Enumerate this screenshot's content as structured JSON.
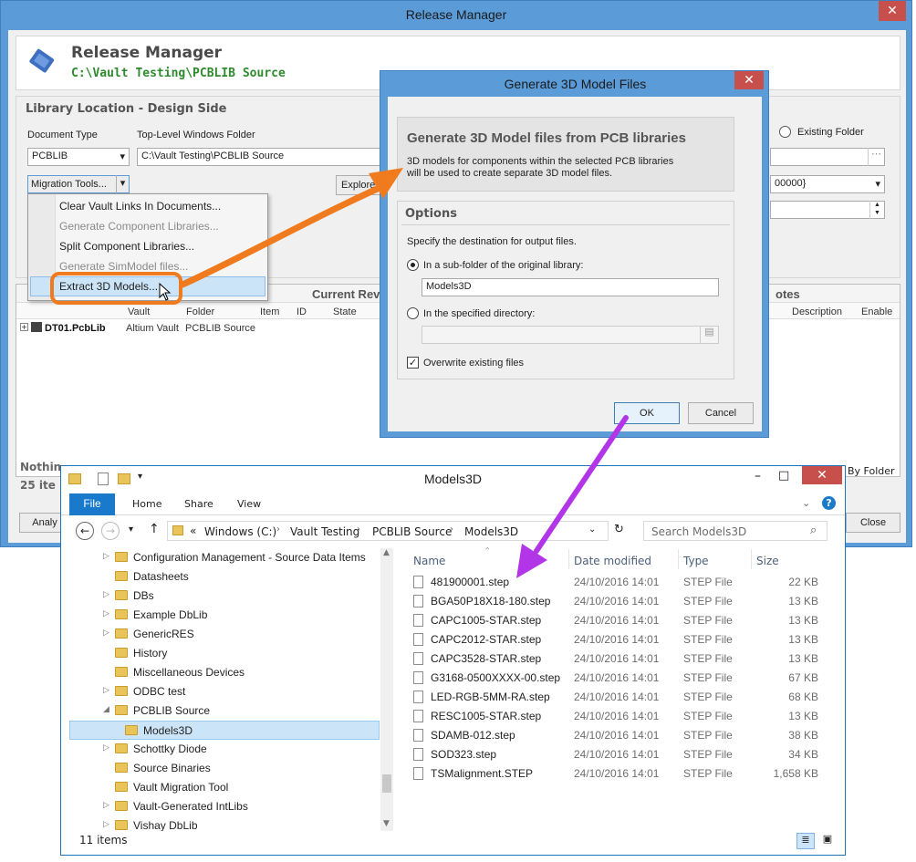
{
  "release_manager": {
    "window_title": "Release Manager",
    "close_glyph": "✕",
    "heading": "Release Manager",
    "path": "C:\\Vault Testing\\PCBLIB Source",
    "panel_title": "Library Location - Design Side",
    "document_type_label": "Document Type",
    "document_type_value": "PCBLIB",
    "folder_label": "Top-Level Windows Folder",
    "folder_value": "C:\\Vault Testing\\PCBLIB Source",
    "existing_folder_label": "Existing Folder",
    "migration_tools_label": "Migration Tools...",
    "explore_label": "Explore",
    "vault_combo_value": "00000}",
    "menu_items": [
      {
        "label": "Clear Vault Links In Documents...",
        "enabled": true
      },
      {
        "label": "Generate Component Libraries...",
        "enabled": false
      },
      {
        "label": "Split Component Libraries...",
        "enabled": true
      },
      {
        "label": "Generate SimModel files...",
        "enabled": false
      },
      {
        "label": "Extract 3D Models...",
        "enabled": true
      }
    ],
    "grid_group_current_rev": "Current Rev",
    "grid_group_notes": "otes",
    "grid_columns": [
      "Vault",
      "Folder",
      "Item",
      "ID",
      "State",
      "Description",
      "Enable"
    ],
    "row_name": "DT01.PcbLib",
    "row_vault": "Altium Vault",
    "row_folder": "PCBLIB Source",
    "nothing_selected": "Nothin",
    "items_count": "25 ite",
    "by_folder": "By Folder",
    "analyze_label": "Analy",
    "close_label": "Close"
  },
  "generate_dialog": {
    "title": "Generate 3D Model Files",
    "close_glyph": "✕",
    "heading": "Generate 3D Model files from PCB libraries",
    "description": "3D models for components within the selected PCB libraries will be used to create separate 3D model files.",
    "options_title": "Options",
    "destination_text": "Specify the destination for output files.",
    "radio_subfolder": "In a sub-folder of the original library:",
    "subfolder_value": "Models3D",
    "radio_directory": "In the specified directory:",
    "directory_value": "",
    "overwrite_label": "Overwrite existing files",
    "ok_label": "OK",
    "cancel_label": "Cancel"
  },
  "explorer": {
    "title": "Models3D",
    "ribbon_tabs": [
      "File",
      "Home",
      "Share",
      "View"
    ],
    "breadcrumb": [
      "Windows (C:)",
      "Vault Testing",
      "PCBLIB Source",
      "Models3D"
    ],
    "breadcrumb_prefix": "«",
    "search_placeholder": "Search Models3D",
    "nav_items": [
      {
        "label": "Configuration Management - Source Data Items",
        "expander": true,
        "indent": 0,
        "selected": false
      },
      {
        "label": "Datasheets",
        "expander": false,
        "indent": 0,
        "selected": false
      },
      {
        "label": "DBs",
        "expander": true,
        "indent": 0,
        "selected": false
      },
      {
        "label": "Example DbLib",
        "expander": true,
        "indent": 0,
        "selected": false
      },
      {
        "label": "GenericRES",
        "expander": true,
        "indent": 0,
        "selected": false
      },
      {
        "label": "History",
        "expander": false,
        "indent": 0,
        "selected": false
      },
      {
        "label": "Miscellaneous Devices",
        "expander": false,
        "indent": 0,
        "selected": false
      },
      {
        "label": "ODBC test",
        "expander": true,
        "indent": 0,
        "selected": false
      },
      {
        "label": "PCBLIB Source",
        "expander": true,
        "indent": 0,
        "selected": false,
        "expanded": true
      },
      {
        "label": "Models3D",
        "expander": false,
        "indent": 1,
        "selected": true
      },
      {
        "label": "Schottky Diode",
        "expander": true,
        "indent": 0,
        "selected": false
      },
      {
        "label": "Source Binaries",
        "expander": false,
        "indent": 0,
        "selected": false
      },
      {
        "label": "Vault Migration Tool",
        "expander": false,
        "indent": 0,
        "selected": false
      },
      {
        "label": "Vault-Generated IntLibs",
        "expander": true,
        "indent": 0,
        "selected": false
      },
      {
        "label": "Vishay DbLib",
        "expander": true,
        "indent": 0,
        "selected": false
      }
    ],
    "columns": [
      "Name",
      "Date modified",
      "Type",
      "Size"
    ],
    "files": [
      {
        "name": "481900001.step",
        "date": "24/10/2016 14:01",
        "type": "STEP File",
        "size": "22 KB"
      },
      {
        "name": "BGA50P18X18-180.step",
        "date": "24/10/2016 14:01",
        "type": "STEP File",
        "size": "13 KB"
      },
      {
        "name": "CAPC1005-STAR.step",
        "date": "24/10/2016 14:01",
        "type": "STEP File",
        "size": "13 KB"
      },
      {
        "name": "CAPC2012-STAR.step",
        "date": "24/10/2016 14:01",
        "type": "STEP File",
        "size": "13 KB"
      },
      {
        "name": "CAPC3528-STAR.step",
        "date": "24/10/2016 14:01",
        "type": "STEP File",
        "size": "13 KB"
      },
      {
        "name": "G3168-0500XXXX-00.step",
        "date": "24/10/2016 14:01",
        "type": "STEP File",
        "size": "67 KB"
      },
      {
        "name": "LED-RGB-5MM-RA.step",
        "date": "24/10/2016 14:01",
        "type": "STEP File",
        "size": "68 KB"
      },
      {
        "name": "RESC1005-STAR.step",
        "date": "24/10/2016 14:01",
        "type": "STEP File",
        "size": "13 KB"
      },
      {
        "name": "SDAMB-012.step",
        "date": "24/10/2016 14:01",
        "type": "STEP File",
        "size": "38 KB"
      },
      {
        "name": "SOD323.step",
        "date": "24/10/2016 14:01",
        "type": "STEP File",
        "size": "34 KB"
      },
      {
        "name": "TSMalignment.STEP",
        "date": "24/10/2016 14:01",
        "type": "STEP File",
        "size": "1,658 KB"
      }
    ],
    "status_count": "11 items"
  },
  "colors": {
    "window_frame": "#5a9bd8",
    "close_button": "#c7504c",
    "accent_green": "#2d8a2d",
    "callout_orange": "#f07a1e",
    "callout_purple": "#b236e8",
    "selection_blue": "#cce4f7"
  }
}
